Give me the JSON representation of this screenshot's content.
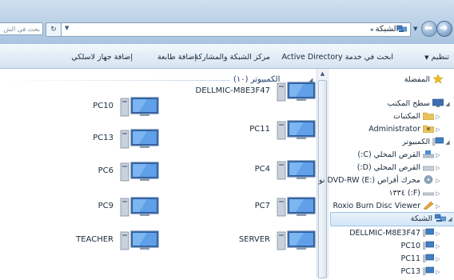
{
  "address_bar": {
    "breadcrumb": "الشبكة",
    "search_placeholder": "بحث في الش"
  },
  "command_bar": {
    "organize": "تنظيم",
    "search_ad": "ابحث في خدمة Active Directory",
    "network_center": "مركز الشبكة والمشاركة",
    "add_printer": "إضافة طابعة",
    "add_wireless_device": "إضافة جهاز لاسلكي"
  },
  "content": {
    "group_header": "الكمبيوتر (١٠)",
    "computers": [
      {
        "name": "DELLMIC-M8E3F47"
      },
      {
        "name": "PC10"
      },
      {
        "name": "PC11"
      },
      {
        "name": "PC13"
      },
      {
        "name": "PC4"
      },
      {
        "name": "PC6"
      },
      {
        "name": "PC7"
      },
      {
        "name": "PC9"
      },
      {
        "name": "SERVER"
      },
      {
        "name": "TEACHER"
      }
    ]
  },
  "nav_pane": {
    "items": [
      {
        "label": "المفضلة"
      },
      {
        "label": "سطح المكتب"
      },
      {
        "label": "المكتبات"
      },
      {
        "label": "Administrator"
      },
      {
        "label": "الكمبيوتر"
      },
      {
        "label": "القرص المحلي (C:)"
      },
      {
        "label": "القرص المحلي (D:)"
      },
      {
        "label": "محرك أقراص DVD-RW (E:) نو"
      },
      {
        "label": "(F:) ١٣٣٤"
      },
      {
        "label": "Roxio Burn Disc Viewer"
      },
      {
        "label": "الشبكة"
      },
      {
        "label": "DELLMIC-M8E3F47"
      },
      {
        "label": "PC10"
      },
      {
        "label": "PC11"
      },
      {
        "label": "PC13"
      }
    ]
  },
  "icons": {
    "computer": "computer-monitor-icon",
    "network": "network-icon",
    "star": "favorites-star-icon",
    "folder": "libraries-folder-icon",
    "drive": "drive-icon",
    "dvd": "dvd-drive-icon"
  }
}
